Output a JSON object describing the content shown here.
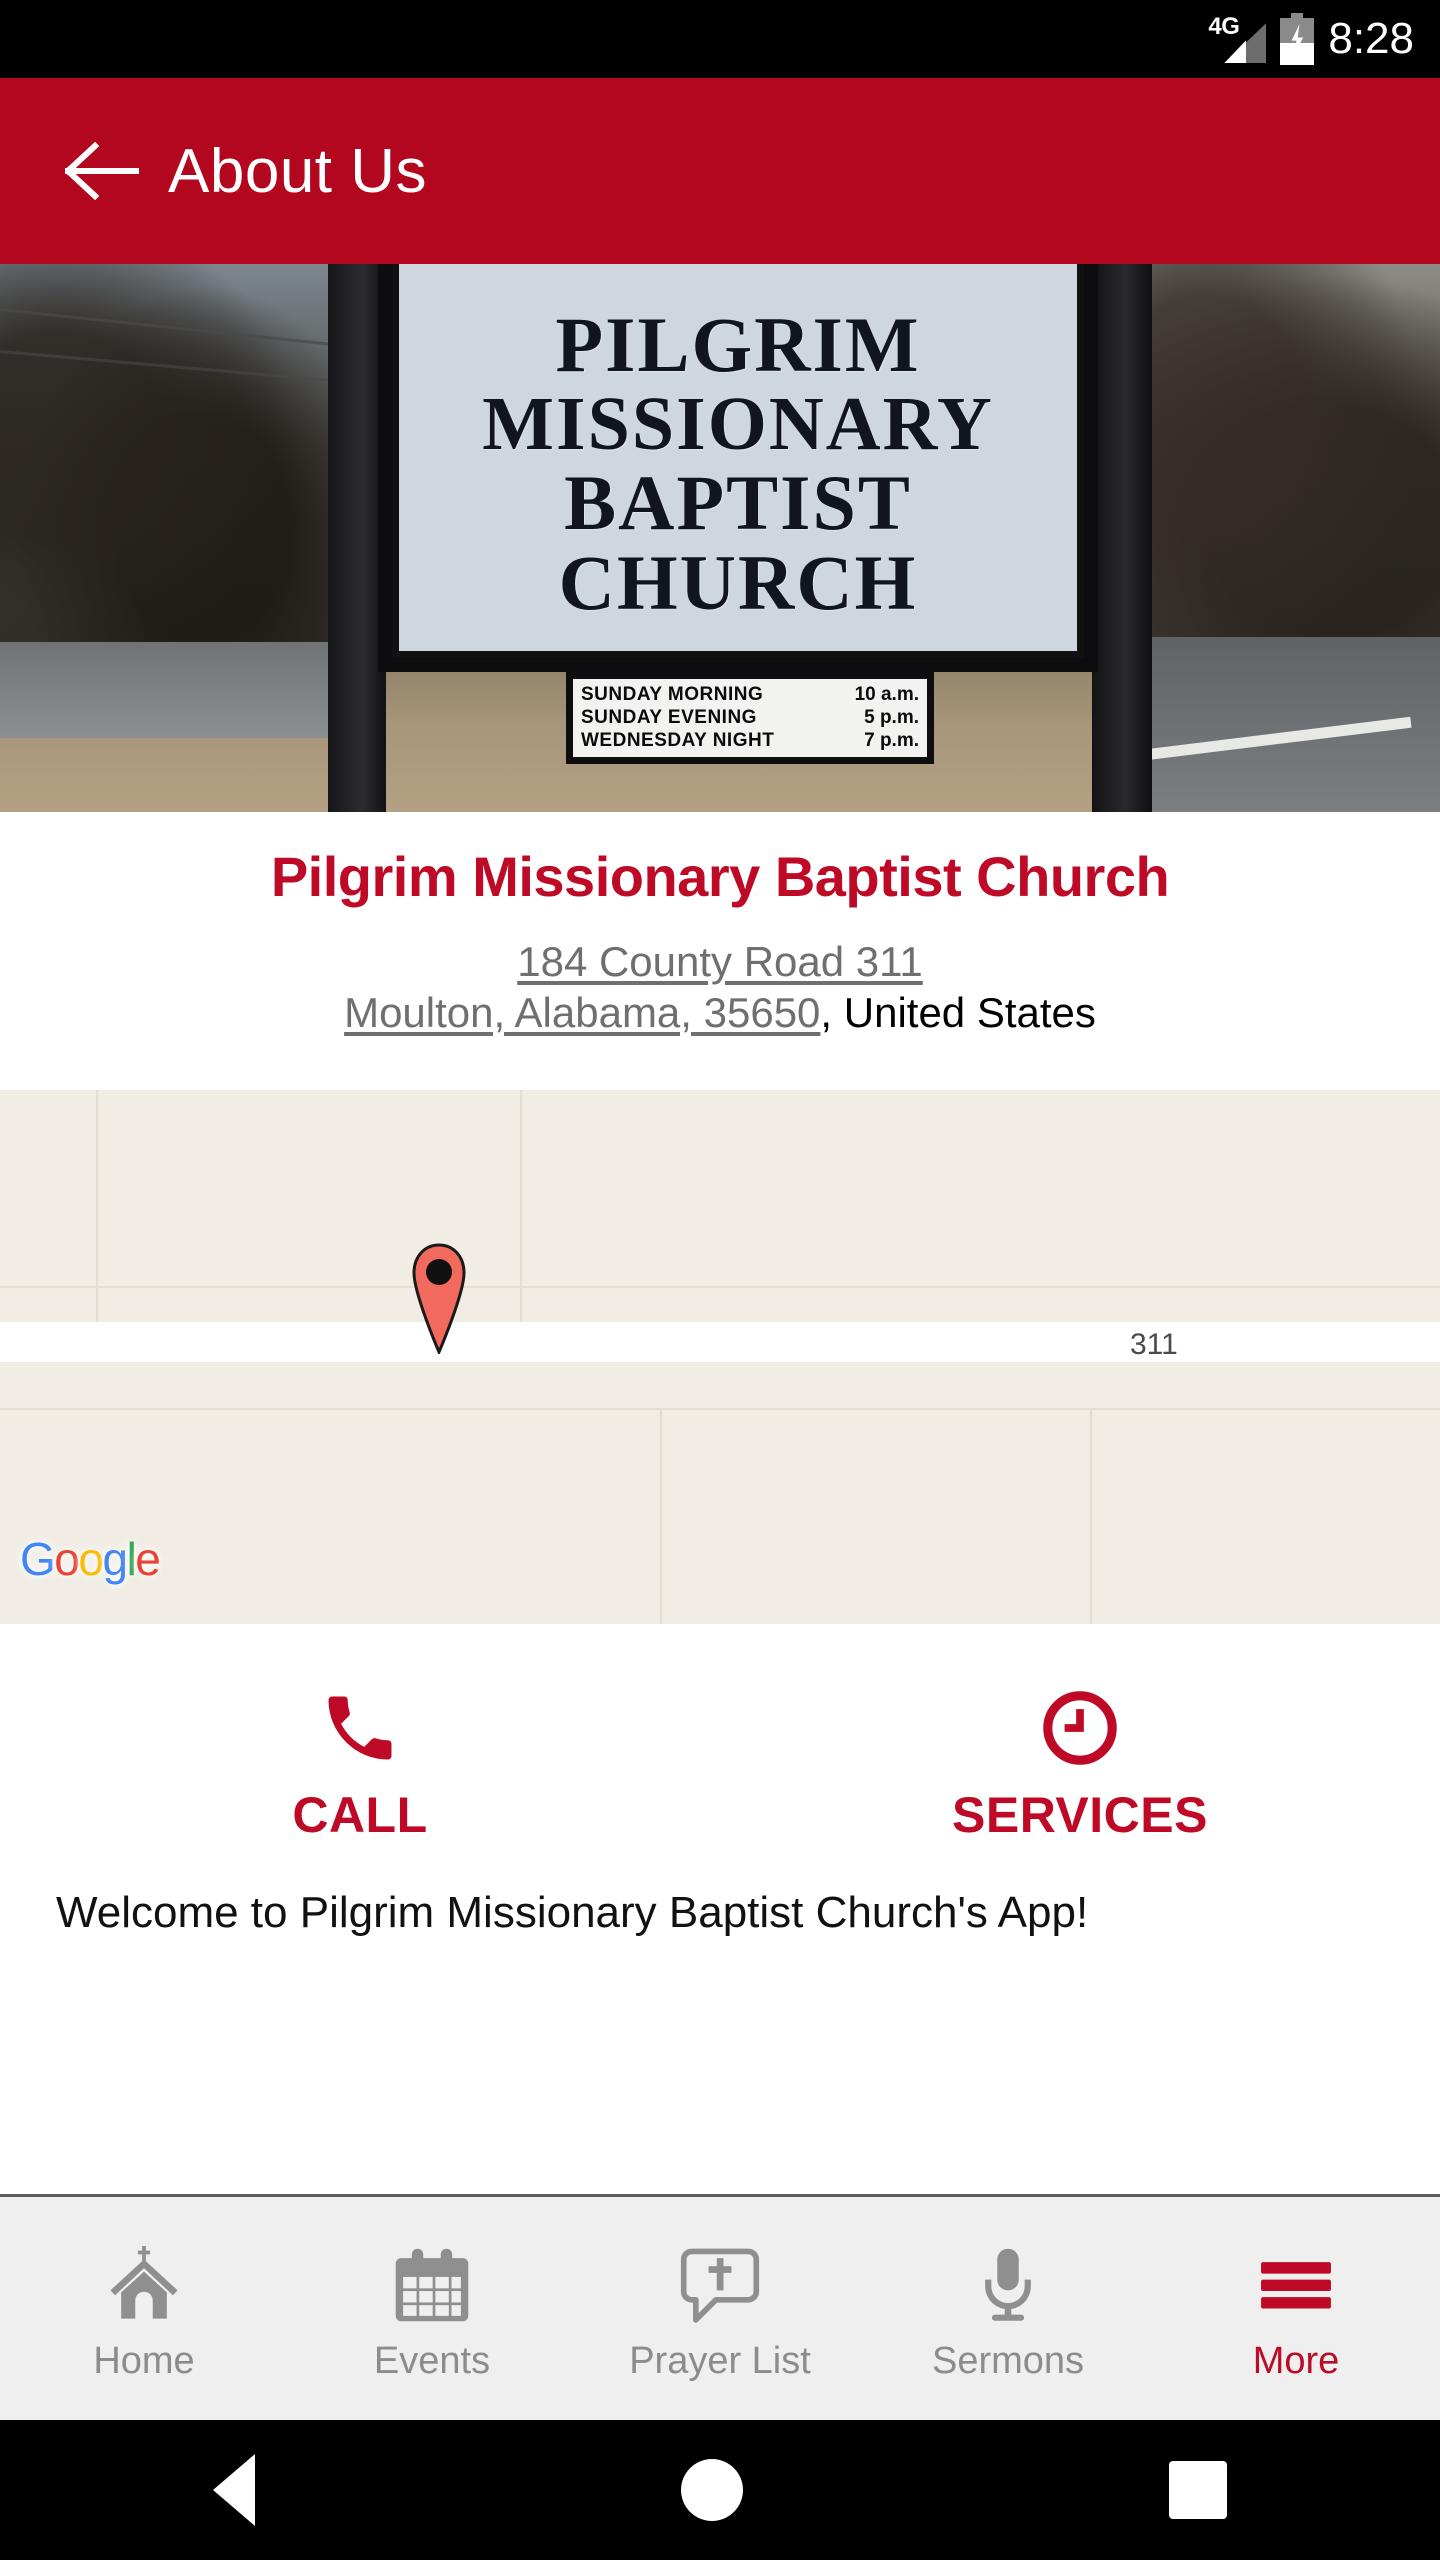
{
  "status_bar": {
    "network": "4G",
    "time": "8:28",
    "battery_state": "charging"
  },
  "app_bar": {
    "back_icon": "arrow-left-icon",
    "title": "About Us",
    "background_color": "#B3061F"
  },
  "hero_photo": {
    "alt": "Church road sign photograph",
    "sign_lines": [
      "PILGRIM",
      "MISSIONARY",
      "BAPTIST",
      "CHURCH"
    ],
    "service_times": [
      {
        "label": "SUNDAY MORNING",
        "time": "10 a.m."
      },
      {
        "label": "SUNDAY EVENING",
        "time": "5 p.m."
      },
      {
        "label": "WEDNESDAY NIGHT",
        "time": "7 p.m."
      }
    ]
  },
  "church_info": {
    "name": "Pilgrim Missionary Baptist Church",
    "name_color": "#BE0A26",
    "address_line1": "184 County Road 311",
    "address_line2": "Moulton, Alabama, 35650",
    "address_country": ", United States"
  },
  "map": {
    "provider_logo": "Google",
    "road_label": "311",
    "marker_icon": "map-pin-icon",
    "marker_color": "#F2695E",
    "background_color": "#f1ede5"
  },
  "actions": [
    {
      "icon": "phone-icon",
      "label": "CALL"
    },
    {
      "icon": "clock-icon",
      "label": "SERVICES"
    }
  ],
  "welcome_text": "Welcome to Pilgrim Missionary Baptist Church's App!",
  "tab_bar": {
    "active_color": "#BE0A26",
    "inactive_color": "#8c8c8c",
    "tabs": [
      {
        "icon": "church-icon",
        "label": "Home",
        "active": false
      },
      {
        "icon": "calendar-icon",
        "label": "Events",
        "active": false
      },
      {
        "icon": "prayer-bubble-icon",
        "label": "Prayer List",
        "active": false
      },
      {
        "icon": "microphone-icon",
        "label": "Sermons",
        "active": false
      },
      {
        "icon": "hamburger-menu-icon",
        "label": "More",
        "active": true
      }
    ]
  },
  "android_nav": {
    "back": "triangle-back-icon",
    "home": "circle-home-icon",
    "recents": "square-recents-icon"
  }
}
